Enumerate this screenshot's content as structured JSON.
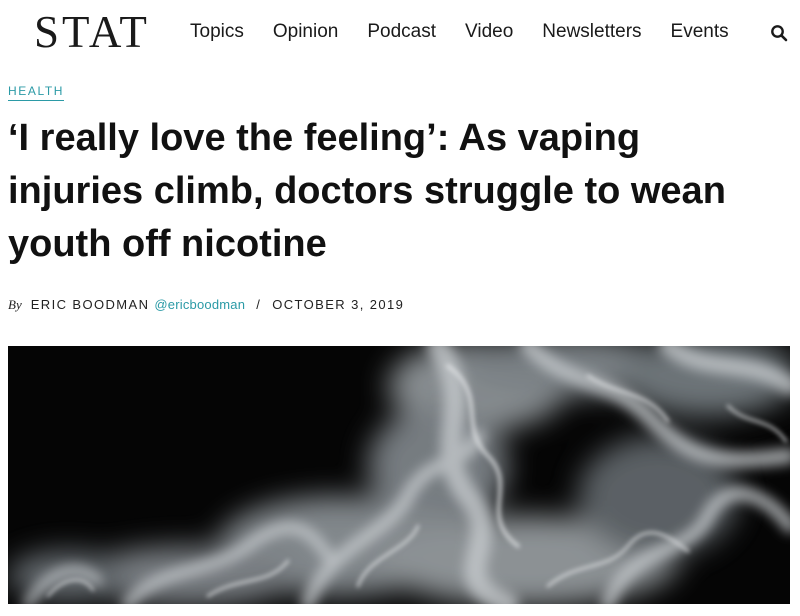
{
  "site": {
    "logo": "STAT"
  },
  "nav": {
    "items": [
      {
        "label": "Topics"
      },
      {
        "label": "Opinion"
      },
      {
        "label": "Podcast"
      },
      {
        "label": "Video"
      },
      {
        "label": "Newsletters"
      },
      {
        "label": "Events"
      }
    ],
    "search_icon": "search-icon"
  },
  "article": {
    "category": "HEALTH",
    "headline": "‘I really love the feeling’: As vaping injuries climb, doctors struggle to wean youth off nicotine",
    "byline": {
      "prefix": "By",
      "author": "ERIC BOODMAN",
      "twitter": "@ericboodman",
      "separator": "/",
      "date": "OCTOBER 3, 2019"
    },
    "hero_image": "vapor-smoke-image"
  },
  "colors": {
    "accent": "#2b9aa6",
    "text": "#111111",
    "hero_background": "#050505"
  }
}
